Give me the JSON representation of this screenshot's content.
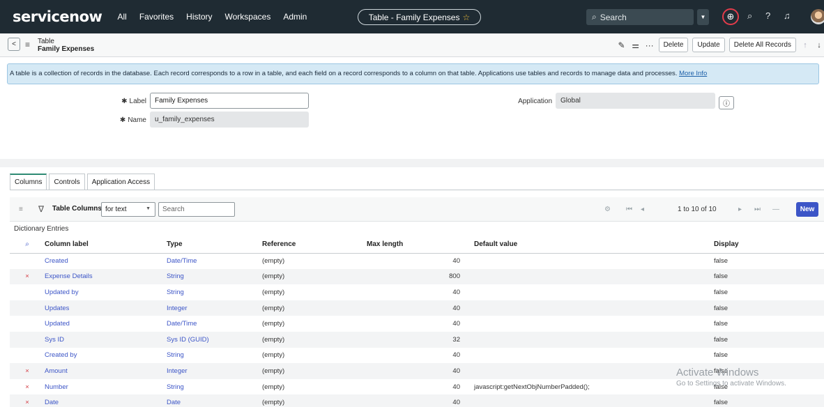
{
  "nav": {
    "logo": "servicenow",
    "menu": [
      "All",
      "Favorites",
      "History",
      "Workspaces",
      "Admin"
    ],
    "title_pill": "Table - Family Expenses",
    "search_placeholder": "Search",
    "icons": [
      "globe-icon",
      "chat-icon",
      "help-icon",
      "bell-icon",
      "avatar"
    ]
  },
  "record_header": {
    "line1": "Table",
    "line2": "Family Expenses",
    "buttons": {
      "delete": "Delete",
      "update": "Update",
      "delete_all": "Delete All Records"
    }
  },
  "banner": {
    "text": "A table is a collection of records in the database. Each record corresponds to a row in a table, and each field on a record corresponds to a column on that table. Applications use tables and records to manage data and processes.",
    "link": "More Info"
  },
  "form": {
    "label_label": "Label",
    "label_value": "Family Expenses",
    "name_label": "Name",
    "name_value": "u_family_expenses",
    "application_label": "Application",
    "application_value": "Global"
  },
  "tabs": [
    "Columns",
    "Controls",
    "Application Access"
  ],
  "list_toolbar": {
    "title": "Table Columns",
    "search_field": "for text",
    "search_placeholder": "Search",
    "pagination": "1  to 10 of 10",
    "new_label": "New"
  },
  "dictionary_label": "Dictionary Entries",
  "table": {
    "headers": [
      "Column label",
      "Type",
      "Reference",
      "Max length",
      "Default value",
      "Display"
    ],
    "rows": [
      {
        "x": "",
        "label": "Created",
        "type": "Date/Time",
        "ref": "(empty)",
        "max": "40",
        "def": "",
        "disp": "false"
      },
      {
        "x": "×",
        "label": "Expense Details",
        "type": "String",
        "ref": "(empty)",
        "max": "800",
        "def": "",
        "disp": "false"
      },
      {
        "x": "",
        "label": "Updated by",
        "type": "String",
        "ref": "(empty)",
        "max": "40",
        "def": "",
        "disp": "false"
      },
      {
        "x": "",
        "label": "Updates",
        "type": "Integer",
        "ref": "(empty)",
        "max": "40",
        "def": "",
        "disp": "false"
      },
      {
        "x": "",
        "label": "Updated",
        "type": "Date/Time",
        "ref": "(empty)",
        "max": "40",
        "def": "",
        "disp": "false"
      },
      {
        "x": "",
        "label": "Sys ID",
        "type": "Sys ID (GUID)",
        "ref": "(empty)",
        "max": "32",
        "def": "",
        "disp": "false"
      },
      {
        "x": "",
        "label": "Created by",
        "type": "String",
        "ref": "(empty)",
        "max": "40",
        "def": "",
        "disp": "false"
      },
      {
        "x": "×",
        "label": "Amount",
        "type": "Integer",
        "ref": "(empty)",
        "max": "40",
        "def": "",
        "disp": "false"
      },
      {
        "x": "×",
        "label": "Number",
        "type": "String",
        "ref": "(empty)",
        "max": "40",
        "def": "javascript:getNextObjNumberPadded();",
        "disp": "false"
      },
      {
        "x": "×",
        "label": "Date",
        "type": "Date",
        "ref": "(empty)",
        "max": "40",
        "def": "",
        "disp": "false"
      }
    ]
  },
  "watermark": {
    "line1": "Activate Windows",
    "line2": "Go to Settings to activate Windows."
  }
}
